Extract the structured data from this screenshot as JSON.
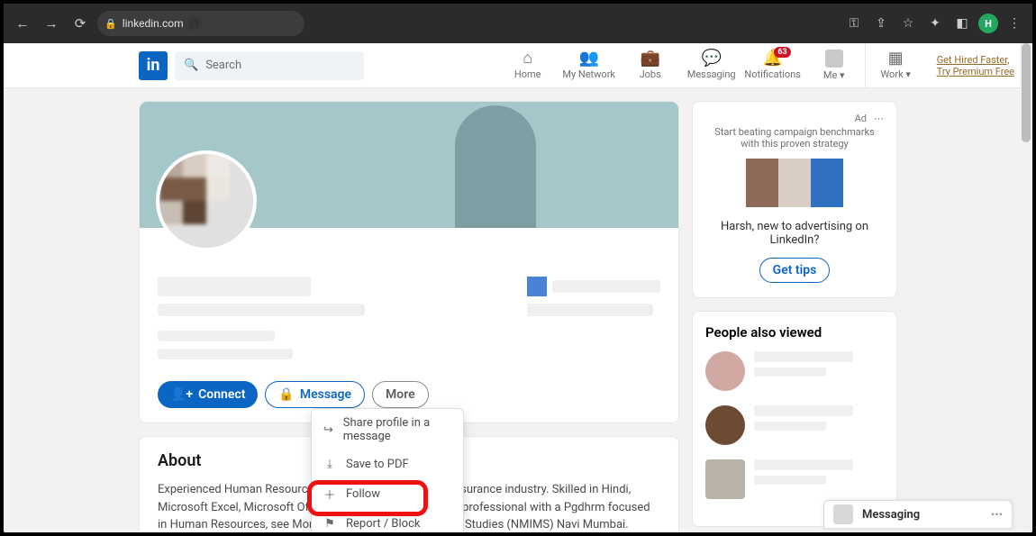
{
  "browser": {
    "url_domain": "linkedin.com",
    "url_rest": "/in",
    "profile_letter": "H"
  },
  "nav": {
    "search_placeholder": "Search",
    "items": [
      {
        "key": "home",
        "label": "Home"
      },
      {
        "key": "network",
        "label": "My Network"
      },
      {
        "key": "jobs",
        "label": "Jobs"
      },
      {
        "key": "messaging",
        "label": "Messaging"
      },
      {
        "key": "notifications",
        "label": "Notifications",
        "badge": "63"
      },
      {
        "key": "me",
        "label": "Me ▾"
      },
      {
        "key": "work",
        "label": "Work ▾"
      }
    ],
    "promo1": "Get Hired Faster,",
    "promo2": "Try Premium Free"
  },
  "profile": {
    "connect": "Connect",
    "message": "Message",
    "more": "More",
    "dropdown": {
      "share": "Share profile in a message",
      "save": "Save to PDF",
      "follow": "Follow",
      "report": "Report / Block"
    }
  },
  "about": {
    "heading": "About",
    "text": "Experienced Human Resources Executive working in the insurance industry. Skilled in Hindi, Microsoft Excel, Microsoft Office, strong human resources professional with a Pgdhrm focused in Human Resources, see Monjee Institute of Management Studies (NMIMS) Navi Mumbai."
  },
  "ad": {
    "label": "Ad",
    "text": "Start beating campaign benchmarks with this proven strategy",
    "question": "Harsh, new to advertising on LinkedIn?",
    "cta": "Get tips"
  },
  "pav": {
    "heading": "People also viewed"
  },
  "messaging": {
    "label": "Messaging"
  }
}
